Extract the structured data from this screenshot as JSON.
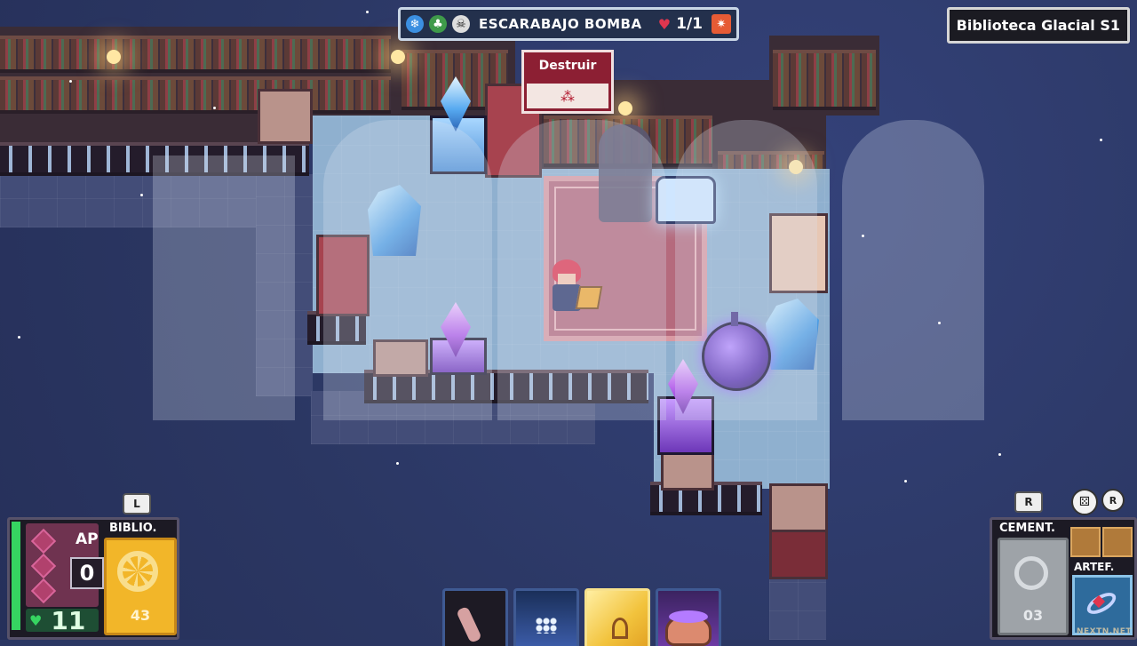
{
  "game": {
    "location": "Biblioteca Glacial S1",
    "enemy": {
      "name": "ESCARABAJO BOMBA",
      "hp": "1/1",
      "status_icons": [
        "snowflake-icon",
        "tree-icon",
        "skull-icon"
      ],
      "trait_icon": "burst-icon"
    },
    "tooltip": {
      "title": "Destruir",
      "icon": "beetle-icon"
    },
    "controls": {
      "left_hint": "L",
      "right_hint": "R",
      "right_hint_small": "R"
    },
    "player": {
      "ap_label": "AP",
      "ap": "0",
      "hp": "11"
    },
    "library": {
      "label": "BIBLIO.",
      "count": "43"
    },
    "graveyard": {
      "label": "CEMENT.",
      "count": "03"
    },
    "artifact": {
      "label": "ARTEF.",
      "icon": "ring-icon"
    },
    "hand": [
      {
        "name": "claw-card"
      },
      {
        "name": "frost-card"
      },
      {
        "name": "leaf-card"
      },
      {
        "name": "cauldron-card"
      }
    ],
    "credit": "NEXTN.NET",
    "colors": {
      "hp_green": "#36d461",
      "ap_magenta": "#6f3350",
      "library_gold": "#f2b629",
      "tooltip_red": "#8c1f33",
      "enemy_bar": "#23304c"
    }
  }
}
